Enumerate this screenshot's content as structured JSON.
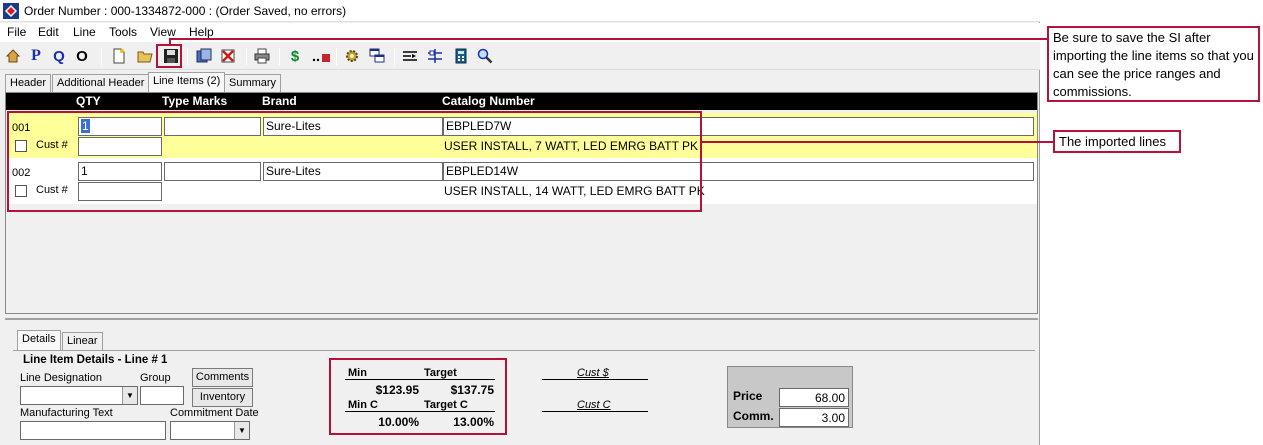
{
  "window": {
    "title": "Order Number : 000-1334872-000 : (Order Saved, no errors)"
  },
  "menu": [
    "File",
    "Edit",
    "Line",
    "Tools",
    "View",
    "Help"
  ],
  "toolbar": {
    "icons": [
      "home-icon",
      "p-icon",
      "q-icon",
      "o-icon",
      "new-doc-icon",
      "open-folder-icon",
      "save-icon",
      "copy-icon",
      "delete-icon",
      "print-icon",
      "dollar-icon",
      "move-icon",
      "gear-icon",
      "windows-icon",
      "split-icon",
      "align-icon",
      "calculator-icon",
      "search-icon"
    ],
    "p_label": "P",
    "q_label": "Q",
    "o_label": "O",
    "dollar_label": "$"
  },
  "tabs": [
    "Header",
    "Additional Header",
    "Line Items (2)",
    "Summary"
  ],
  "grid": {
    "columns": [
      "QTY",
      "Type Marks",
      "Brand",
      "Catalog Number"
    ],
    "rows": [
      {
        "num": "001",
        "qty": "1",
        "type_marks": "",
        "brand": "Sure-Lites",
        "catalog": "EBPLED7W",
        "cust_label": "Cust #",
        "description": "USER INSTALL, 7 WATT, LED EMRG BATT PK"
      },
      {
        "num": "002",
        "qty": "1",
        "type_marks": "",
        "brand": "Sure-Lites",
        "catalog": "EBPLED14W",
        "cust_label": "Cust #",
        "description": "USER INSTALL, 14 WATT, LED EMRG BATT PK"
      }
    ]
  },
  "bottom": {
    "tabs": [
      "Details",
      "Linear"
    ],
    "section_title": "Line Item Details - Line # 1",
    "line_designation_label": "Line Designation",
    "group_label": "Group",
    "comments_button": "Comments",
    "inventory_button": "Inventory",
    "manufacturing_text_label": "Manufacturing Text",
    "commitment_date_label": "Commitment Date",
    "pricing": {
      "min_label": "Min",
      "target_label": "Target",
      "min_value": "$123.95",
      "target_value": "$137.75",
      "min_c_label": "Min C",
      "target_c_label": "Target C",
      "min_c_value": "10.00%",
      "target_c_value": "13.00%",
      "cust_dollar_label": "Cust $",
      "cust_c_label": "Cust C"
    },
    "price_label": "Price",
    "price_value": "68.00",
    "comm_label": "Comm.",
    "comm_value": "3.00"
  },
  "annotations": {
    "save_note": "Be sure to save the SI after importing the line items so that you can see the price ranges and commissions.",
    "imported_note": "The imported lines"
  },
  "colors": {
    "annotation_red": "#b5123a",
    "row_highlight": "#ffff99",
    "grid_header": "#000000"
  }
}
